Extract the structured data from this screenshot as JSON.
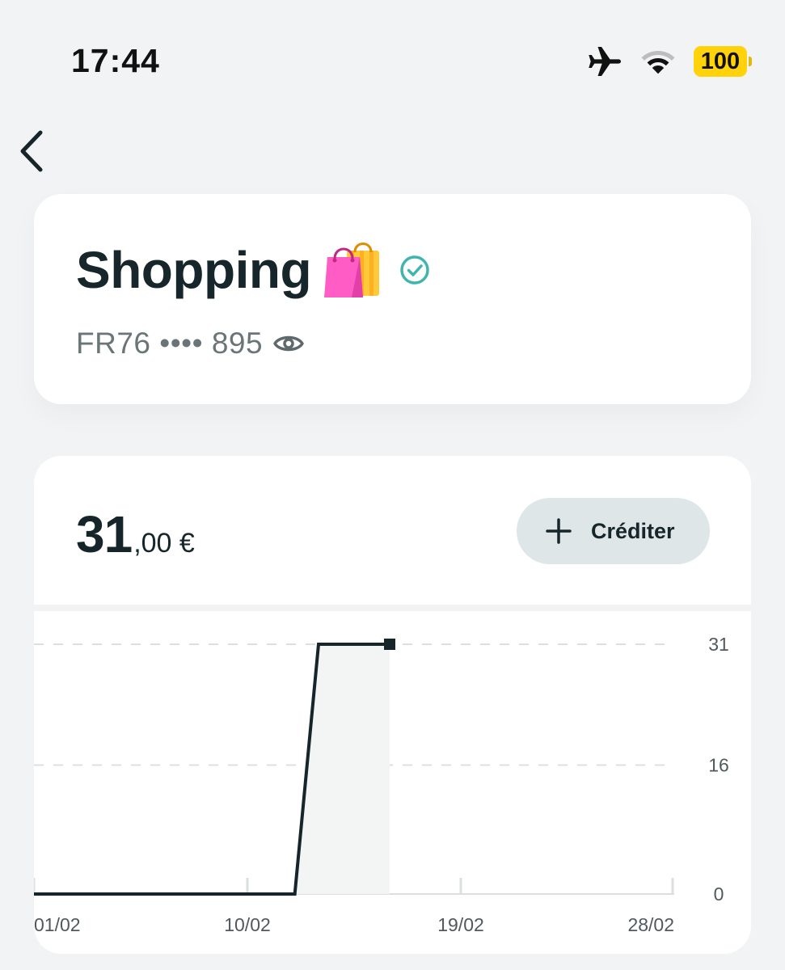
{
  "status_bar": {
    "time": "17:44",
    "battery": "100",
    "icons": [
      "airplane-icon",
      "wifi-icon",
      "battery-icon"
    ]
  },
  "nav": {
    "back_icon": "chevron-left-icon"
  },
  "account": {
    "title": "Shopping",
    "emoji": "shopping-bags-icon",
    "verified_icon": "check-circle-icon",
    "iban_masked": "FR76 •••• 895",
    "visibility_icon": "eye-icon"
  },
  "balance": {
    "integer_part": "31",
    "decimal_part": ",00 €",
    "credit_button_label": "Créditer",
    "credit_icon": "plus-icon"
  },
  "colors": {
    "background": "#f2f3f4",
    "card": "#ffffff",
    "accent_teal": "#3fb6ad",
    "battery": "#ffd20a",
    "line": "#15252a",
    "button_bg": "#dfe6e8"
  },
  "chart_data": {
    "type": "line",
    "title": "",
    "xlabel": "",
    "ylabel": "",
    "x": [
      "01/02",
      "10/02",
      "12/02",
      "13/02",
      "16/02"
    ],
    "series": [
      {
        "values": [
          0,
          0,
          0,
          31,
          31
        ]
      }
    ],
    "x_ticks": [
      "01/02",
      "10/02",
      "19/02",
      "28/02"
    ],
    "y_ticks": [
      "0",
      "16",
      "31"
    ],
    "ylim": [
      0,
      31
    ],
    "y_axis_position": "right",
    "grid": true,
    "end_marker": "square",
    "area_fill": "light grey under last segment"
  }
}
